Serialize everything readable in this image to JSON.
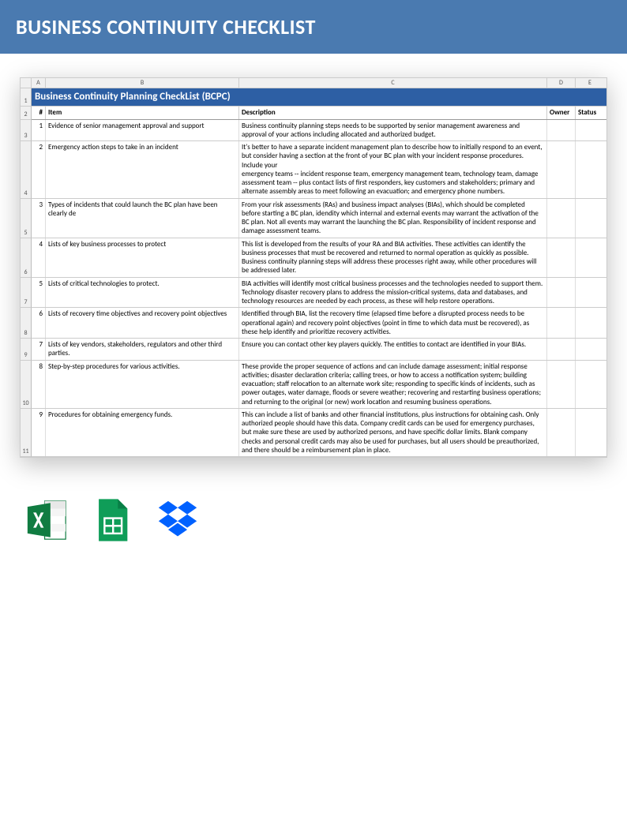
{
  "banner": "BUSINESS CONTINUITY CHECKLIST",
  "sheet_title": "Business Continuity Planning CheckList (BCPC)",
  "col_letters": [
    "A",
    "B",
    "C",
    "D",
    "E"
  ],
  "headers": {
    "hash": "#",
    "item": "Item",
    "desc": "Description",
    "owner": "Owner",
    "status": "Status"
  },
  "title_rownum": "1",
  "header_rownum": "2",
  "rows": [
    {
      "rn": "3",
      "n": "1",
      "item": "Evidence of senior management approval and support",
      "desc": "Business continuity planning steps  needs to be supported by senior management awareness and approval of your actions including allocated and authorized budget."
    },
    {
      "rn": "4",
      "n": "2",
      "item": "Emergency action steps to take in an incident",
      "desc": "It's better to have a separate incident management plan to describe how to initially respond to an event, but consider having a section at the front of your BC plan with your incident response procedures. Include your\nemergency teams -- incident response team, emergency management team, technology team, damage assessment team -- plus contact lists of first responders, key customers and stakeholders; primary and alternate assembly areas to meet following an evacuation; and emergency phone numbers."
    },
    {
      "rn": "5",
      "n": "3",
      "item": "Types of incidents that could launch the BC plan have been clearly de",
      "desc": "From your risk assessments (RAs) and business impact analyses (BIAs), which should be completed before starting a BC plan, idendity which internal and external events may warrant the activation of the BC plan. Not all events may warrant the launching the BC plan. Responsibility of incident response and damage assessment teams."
    },
    {
      "rn": "6",
      "n": "4",
      "item": "Lists of key business processes to protect",
      "desc": "This list is developed from the results of your RA and BIA activities. These activities can identify the business processes that must be recovered and returned to normal operation as quickly as possible. Business continuity planning steps will  address these processes right away, while other procedures will be addressed later."
    },
    {
      "rn": "7",
      "n": "5",
      "item": "Lists of critical technologies to protect.",
      "desc": "BIA activities will identify most critical business processes and the technologies needed to support them. Technology disaster recovery plans to address the mission-critical systems, data and databases, and technology resources are needed by each process, as these will help restore operations."
    },
    {
      "rn": "8",
      "n": "6",
      "item": "Lists of recovery time objectives and recovery point objectives",
      "desc": "Identified through BIA, list the recovery time (elapsed time before a disrupted process needs to be operational again) and recovery point objectives (point in time to which data must be recovered), as these help identify and prioritize recovery activities."
    },
    {
      "rn": "9",
      "n": "7",
      "item": "Lists of key vendors, stakeholders, regulators and other third parties.",
      "desc": "Ensure you can contact other key players quickly. The entities to contact are identified in your BIAs."
    },
    {
      "rn": "10",
      "n": "8",
      "item": "Step-by-step procedures for various activities.",
      "desc": "These provide the proper sequence of actions and can include damage assessment; initial response activities; disaster declaration criteria; calling trees, or how to access a notification system; building evacuation; staff relocation to an alternate work site; responding to specific kinds of incidents, such as power outages, water damage, floods or severe weather; recovering and restarting business operations; and returning to the original (or new) work location and resuming business operations."
    },
    {
      "rn": "11",
      "n": "9",
      "item": "Procedures for obtaining emergency funds.",
      "desc": "This can include a list of banks and other financial institutions, plus instructions for obtaining cash. Only authorized people should have this data. Company credit cards can be used for emergency purchases, but make sure these are used by authorized persons, and have specific dollar limits. Blank company checks and personal credit cards may also be used for purchases, but all users should be preauthorized, and there should be a reimbursement plan in place."
    }
  ],
  "icons": {
    "excel": "excel-icon",
    "sheets": "google-sheets-icon",
    "dropbox": "dropbox-icon"
  }
}
